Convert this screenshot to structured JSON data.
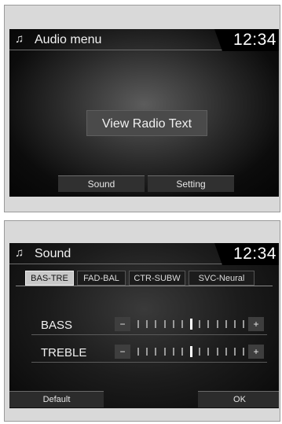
{
  "audio_menu": {
    "title_icon": "music-note-icon",
    "title": "Audio menu",
    "clock": "12:34",
    "view_radio_text": "View Radio Text",
    "buttons": [
      "Sound",
      "Setting"
    ]
  },
  "sound": {
    "title_icon": "music-note-icon",
    "title": "Sound",
    "clock": "12:34",
    "tabs": [
      {
        "label": "BAS-TRE",
        "active": true
      },
      {
        "label": "FAD-BAL",
        "active": false
      },
      {
        "label": "CTR-SUBW",
        "active": false
      },
      {
        "label": "SVC-Neural",
        "active": false
      }
    ],
    "rows": [
      {
        "label": "BASS",
        "minus": "−",
        "plus": "+",
        "level_fraction": 0.5
      },
      {
        "label": "TREBLE",
        "minus": "−",
        "plus": "+",
        "level_fraction": 0.5
      }
    ],
    "default_label": "Default",
    "ok_label": "OK"
  },
  "colors": {
    "screen_bg": "#050505",
    "panel_frame": "#d9d9d9",
    "active_tab": "#c8c8c8"
  }
}
